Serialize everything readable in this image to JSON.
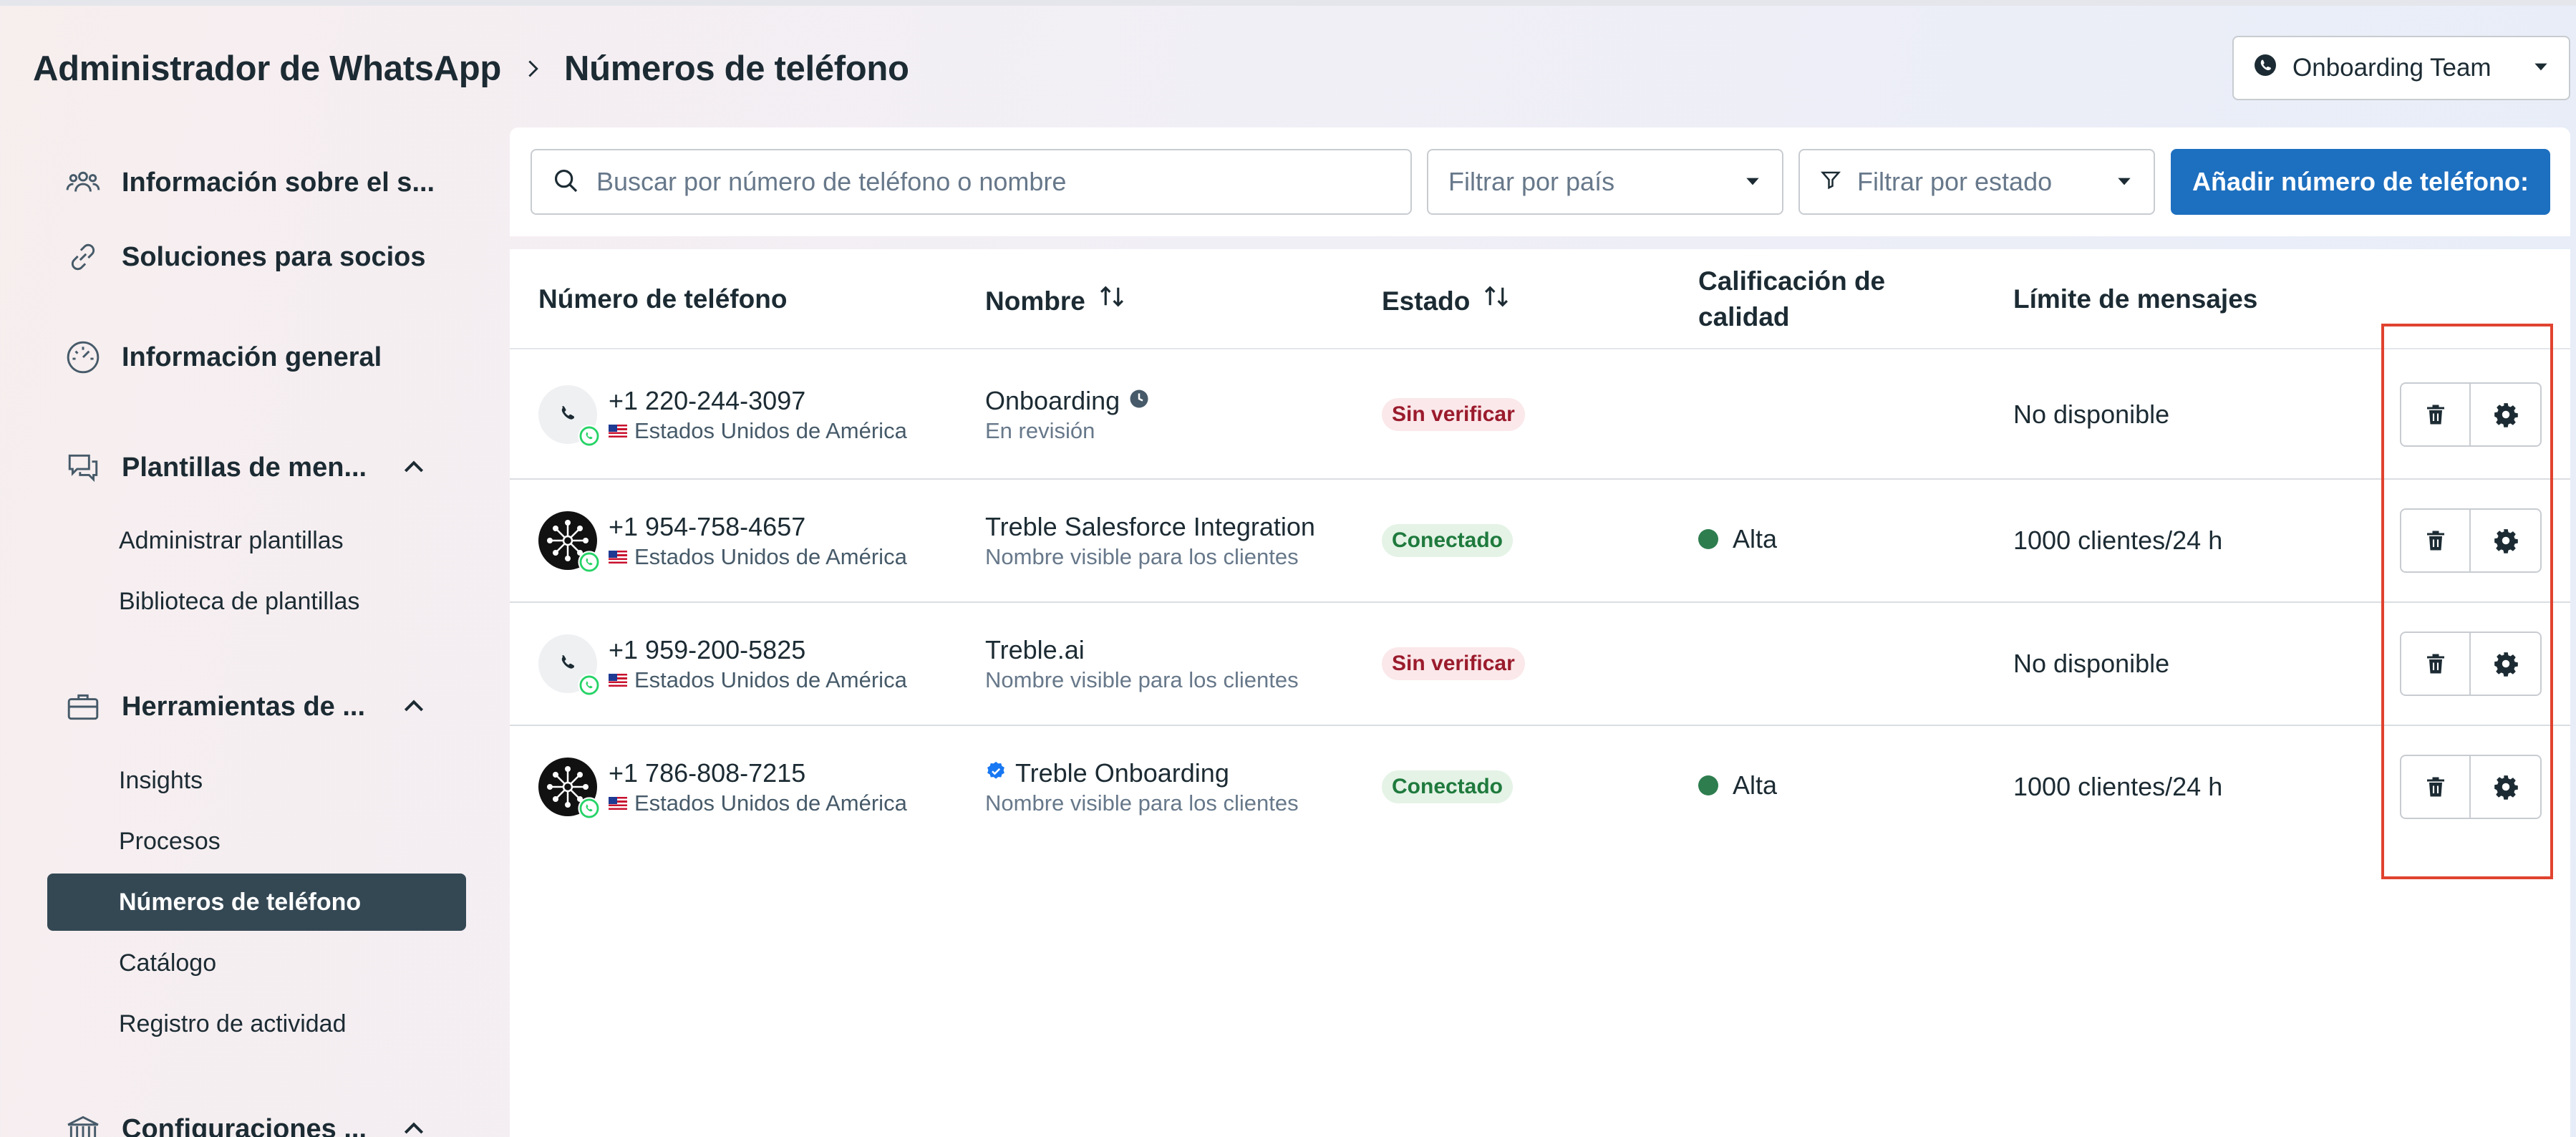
{
  "header": {
    "app_title": "Administrador de WhatsApp",
    "page_title": "Números de teléfono"
  },
  "account": {
    "label": "Onboarding Team"
  },
  "sidebar": {
    "items": [
      {
        "label": "Información sobre el s...",
        "icon": "people-icon"
      },
      {
        "label": "Soluciones para socios",
        "icon": "link-icon"
      },
      {
        "label": "Información general",
        "icon": "dashboard-icon"
      },
      {
        "label": "Plantillas de men...",
        "icon": "chat-bubbles-icon",
        "expanded": true,
        "children": [
          "Administrar plantillas",
          "Biblioteca de plantillas"
        ]
      },
      {
        "label": "Herramientas de ...",
        "icon": "briefcase-icon",
        "expanded": true,
        "children": [
          "Insights",
          "Procesos",
          "Números de teléfono",
          "Catálogo",
          "Registro de actividad"
        ],
        "active_child": "Números de teléfono"
      },
      {
        "label": "Configuraciones ...",
        "icon": "bank-icon",
        "expanded": true
      }
    ]
  },
  "toolbar": {
    "search_placeholder": "Buscar por número de teléfono o nombre",
    "country_filter": "Filtrar por país",
    "status_filter": "Filtrar por estado",
    "add_button": "Añadir número de teléfono:"
  },
  "table": {
    "columns": [
      "Número de teléfono",
      "Nombre",
      "Estado",
      "Calificación de calidad",
      "Límite de mensajes"
    ],
    "rows": [
      {
        "phone": "+1 220-244-3097",
        "country": "Estados Unidos de América",
        "avatar": "phone-icon",
        "name": "Onboarding",
        "name_icon": "clock-icon",
        "subtitle": "En revisión",
        "status": "Sin verificar",
        "status_color": "#9a1b2c",
        "quality": "",
        "limit": "No disponible"
      },
      {
        "phone": "+1 954-758-4657",
        "country": "Estados Unidos de América",
        "avatar": "network-logo",
        "name": "Treble Salesforce Integration",
        "name_icon": "",
        "subtitle": "Nombre visible para los clientes",
        "status": "Conectado",
        "status_color": "#1f7a3d",
        "quality": "Alta",
        "limit": "1000 clientes/24 h"
      },
      {
        "phone": "+1 959-200-5825",
        "country": "Estados Unidos de América",
        "avatar": "phone-icon",
        "name": "Treble.ai",
        "name_icon": "",
        "subtitle": "Nombre visible para los clientes",
        "status": "Sin verificar",
        "status_color": "#9a1b2c",
        "quality": "",
        "limit": "No disponible"
      },
      {
        "phone": "+1 786-808-7215",
        "country": "Estados Unidos de América",
        "avatar": "network-logo",
        "name": "Treble Onboarding",
        "name_icon": "verified-badge-icon",
        "subtitle": "Nombre visible para los clientes",
        "status": "Conectado",
        "status_color": "#1f7a3d",
        "quality": "Alta",
        "limit": "1000 clientes/24 h"
      }
    ]
  },
  "colors": {
    "primary_button": "#1d6fbf",
    "active_nav": "#344854",
    "highlight_box": "#e0432f",
    "quality_dot": "#2e7d4f"
  }
}
